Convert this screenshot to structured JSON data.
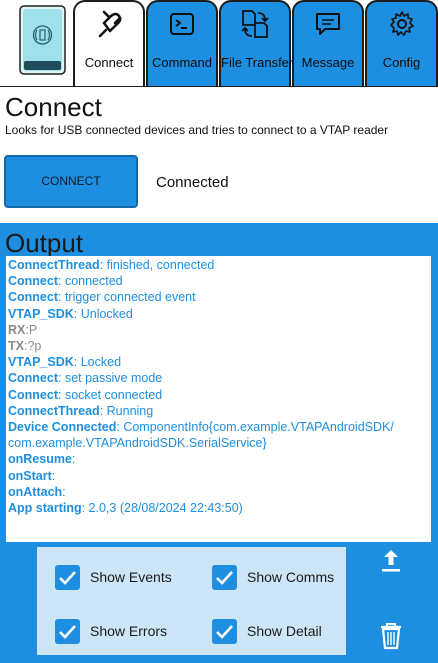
{
  "tabs": [
    {
      "label": "Connect",
      "icon": "plug-icon",
      "active": true
    },
    {
      "label": "Command",
      "icon": "terminal-icon",
      "active": false
    },
    {
      "label": "File Transfer",
      "icon": "file-transfer-icon",
      "active": false
    },
    {
      "label": "Message",
      "icon": "chat-icon",
      "active": false
    },
    {
      "label": "Config",
      "icon": "gear-icon",
      "active": false
    }
  ],
  "connect": {
    "title": "Connect",
    "description": "Looks for USB connected devices and tries to connect to a VTAP reader",
    "button_label": "CONNECT",
    "status": "Connected"
  },
  "output": {
    "title": "Output",
    "log": [
      {
        "key": "ConnectThread",
        "text": ": finished, connected"
      },
      {
        "key": "Connect",
        "text": ":  connected"
      },
      {
        "key": "Connect",
        "text": ": trigger connected event"
      },
      {
        "key": "VTAP_SDK",
        "text": ": Unlocked"
      },
      {
        "key": "RX",
        "text": ":P"
      },
      {
        "key": "TX",
        "text": ":?p"
      },
      {
        "key": "VTAP_SDK",
        "text": ": Locked"
      },
      {
        "key": "Connect",
        "text": ": set passive mode"
      },
      {
        "key": "Connect",
        "text": ":  socket connected"
      },
      {
        "key": "ConnectThread",
        "text": ": Running"
      },
      {
        "key": "Device Connected",
        "text": ": ComponentInfo{com.example.VTAPAndroidSDK/"
      },
      {
        "key": "",
        "text": "com.example.VTAPAndroidSDK.SerialService}"
      },
      {
        "key": "onResume",
        "text": ":"
      },
      {
        "key": "onStart",
        "text": ":"
      },
      {
        "key": "onAttach",
        "text": ":"
      },
      {
        "key": "App starting",
        "text": ": 2.0,3 (28/08/2024 22:43:50)"
      }
    ]
  },
  "options": {
    "show_events": {
      "label": "Show Events",
      "checked": true
    },
    "show_comms": {
      "label": "Show Comms",
      "checked": true
    },
    "show_errors": {
      "label": "Show Errors",
      "checked": true
    },
    "show_detail": {
      "label": "Show Detail",
      "checked": true
    }
  },
  "actions": {
    "upload_icon": "upload-icon",
    "delete_icon": "trash-icon"
  },
  "colors": {
    "accent": "#1e8fe0",
    "log_text": "#1e8fe0",
    "log_grey": "#8a8a8a",
    "options_bg": "#cde6f7"
  }
}
